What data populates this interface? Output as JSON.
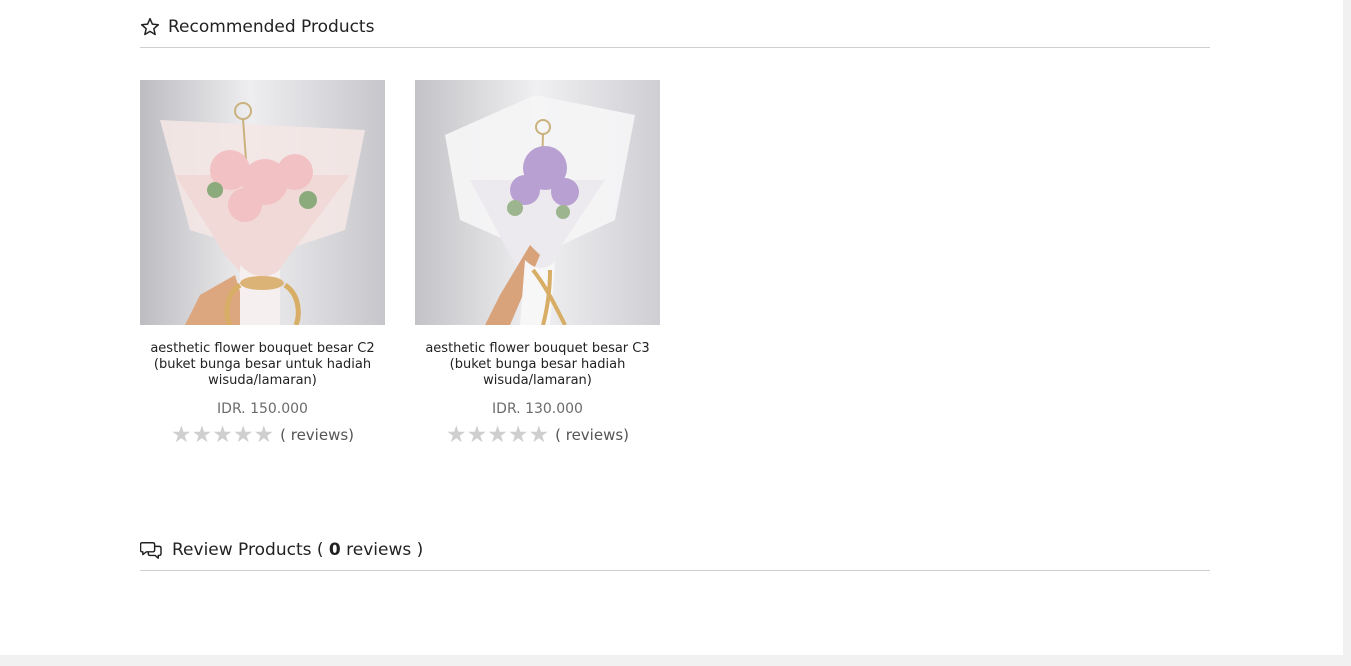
{
  "recommended": {
    "title": "Recommended Products",
    "icon": "star-outline-icon"
  },
  "products": [
    {
      "name": "aesthetic flower bouquet besar C2 (buket bunga besar untuk hadiah wisuda/lamaran)",
      "price": "IDR. 150.000",
      "rating": 0,
      "max_rating": 5,
      "reviews_text": "( reviews)",
      "image": "pink-flower-bouquet-photo",
      "flower_color": "#f2c1c3"
    },
    {
      "name": "aesthetic flower bouquet besar C3 (buket bunga besar hadiah wisuda/lamaran)",
      "price": "IDR. 130.000",
      "rating": 0,
      "max_rating": 5,
      "reviews_text": "( reviews)",
      "image": "lavender-flower-bouquet-photo",
      "flower_color": "#b9a0d2"
    }
  ],
  "review_section": {
    "prefix": "Review Products (",
    "count": "0",
    "suffix": "reviews )",
    "icon": "chat-bubbles-icon"
  },
  "colors": {
    "divider": "#cfcfcf",
    "star_empty": "#cfcfcf",
    "price_text": "#6b6b6b"
  }
}
